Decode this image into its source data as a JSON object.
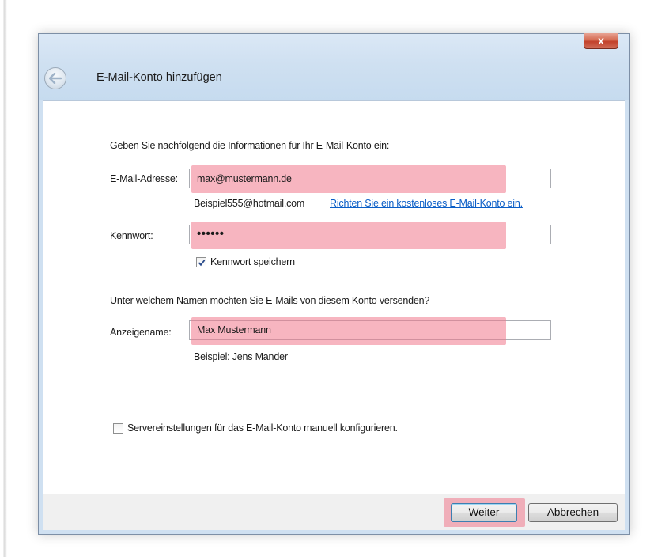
{
  "dialog": {
    "title": "E-Mail-Konto hinzufügen",
    "close_label": "x"
  },
  "form": {
    "intro": "Geben Sie nachfolgend die Informationen für Ihr E-Mail-Konto ein:",
    "email": {
      "label": "E-Mail-Adresse:",
      "value": "max@mustermann.de",
      "example": "Beispiel555@hotmail.com",
      "link": "Richten Sie ein kostenloses E-Mail-Konto ein."
    },
    "password": {
      "label": "Kennwort:",
      "value": "••••••",
      "remember_label": "Kennwort speichern",
      "remember_checked": true
    },
    "name_question": "Unter welchem Namen möchten Sie E-Mails von diesem Konto versenden?",
    "display_name": {
      "label": "Anzeigename:",
      "value": "Max Mustermann",
      "example": "Beispiel: Jens Mander"
    },
    "manual_config": {
      "label": "Servereinstellungen für das E-Mail-Konto manuell konfigurieren.",
      "checked": false
    }
  },
  "buttons": {
    "next": "Weiter",
    "cancel": "Abbrechen"
  },
  "colors": {
    "highlight": "#f0788c",
    "link": "#0a5ec7",
    "title_bar": "#cfe0f1",
    "close_button": "#c2412b"
  },
  "icons": {
    "back": "back-arrow-icon",
    "close": "close-icon",
    "check": "checkmark-icon"
  }
}
